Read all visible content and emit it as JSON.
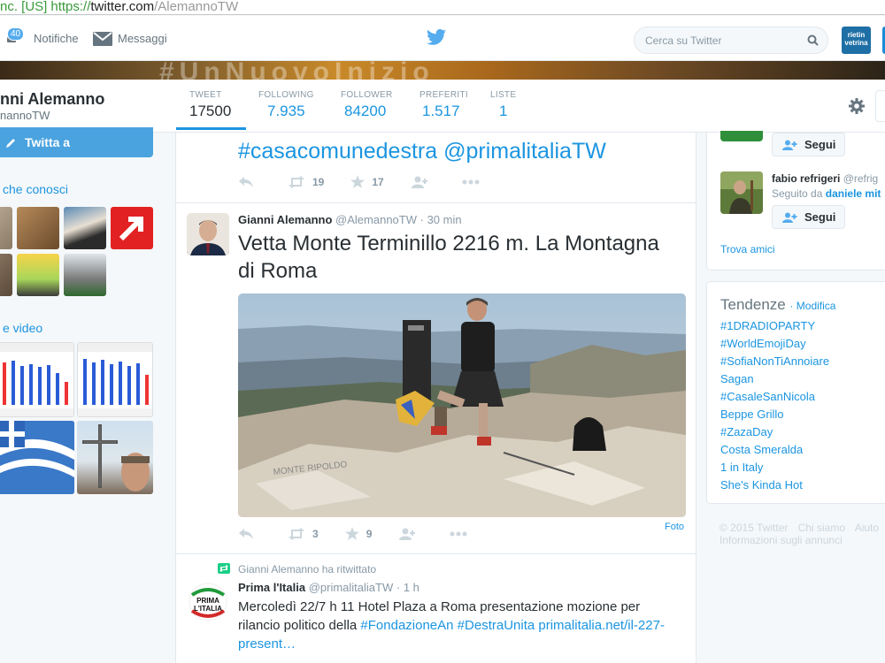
{
  "browser": {
    "cert": "nc. [US]",
    "scheme": "https://",
    "domain": "twitter.com",
    "path": "/AlemannoTW"
  },
  "topnav": {
    "notifications_label": "Notifiche",
    "notifications_count": "40",
    "messages_label": "Messaggi",
    "search_placeholder": "Cerca su Twitter",
    "partner_logo_top": "rietin",
    "partner_logo_bottom": "vetrina"
  },
  "banner": {
    "text": "#UnNuovoInizio"
  },
  "profile": {
    "name": "nni Alemanno",
    "handle": "nannoTW",
    "stats": [
      {
        "label": "TWEET",
        "value": "17500"
      },
      {
        "label": "FOLLOWING",
        "value": "7.935"
      },
      {
        "label": "FOLLOWER",
        "value": "84200"
      },
      {
        "label": "PREFERITI",
        "value": "1.517"
      },
      {
        "label": "LISTE",
        "value": "1"
      }
    ]
  },
  "left": {
    "tweet_to_label": "Twitta a",
    "people_heading": "che conosci",
    "media_heading": "e video"
  },
  "timeline": {
    "tweet0": {
      "text": "#casacomunedestra @primalitaliaTW",
      "retweets": "19",
      "favorites": "17"
    },
    "tweet1": {
      "name": "Gianni Alemanno",
      "handle": "@AlemannoTW",
      "time": "· 30 min",
      "text": "Vetta Monte Terminillo 2216 m. La Montagna di Roma",
      "retweets": "3",
      "favorites": "9",
      "photo_label": "Foto"
    },
    "tweet2": {
      "retweeted_by": "Gianni Alemanno ha ritwittato",
      "name": "Prima l'Italia",
      "handle": "@primalitaliaTW",
      "time": "· 1 h",
      "text_plain": "Mercoledì 22/7 h 11 Hotel Plaza a Roma presentazione mozione per rilancio politico della ",
      "link1": "#FondazioneAn",
      "link2": "#DestraUnita",
      "link3": "primalitalia.net/il-227-present…",
      "avatar_text_top": "PRIMA",
      "avatar_text_bottom": "L'ITALIA"
    }
  },
  "who_to_follow": {
    "follow_label": "Segui",
    "suggestion2_name": "fabio refrigeri",
    "suggestion2_handle": "@refrig",
    "suggestion2_followed_by": "Seguito da",
    "suggestion2_followed_name": "daniele mit",
    "find_friends": "Trova amici"
  },
  "trends": {
    "title": "Tendenze",
    "change": "· Modifica",
    "items": [
      "#1DRADIOPARTY",
      "#WorldEmojiDay",
      "#SofiaNonTiAnnoiare",
      "Sagan",
      "#CasaleSanNicola",
      "Beppe Grillo",
      "#ZazaDay",
      "Costa Smeralda",
      "1 in Italy",
      "She's Kinda Hot"
    ]
  },
  "footer": {
    "copyright": "© 2015 Twitter",
    "about": "Chi siamo",
    "help": "Aiuto",
    "ads_info": "Informazioni sugli annunci"
  },
  "colors": {
    "accent": "#1b95e0",
    "tweet_button": "#4aa3df"
  }
}
